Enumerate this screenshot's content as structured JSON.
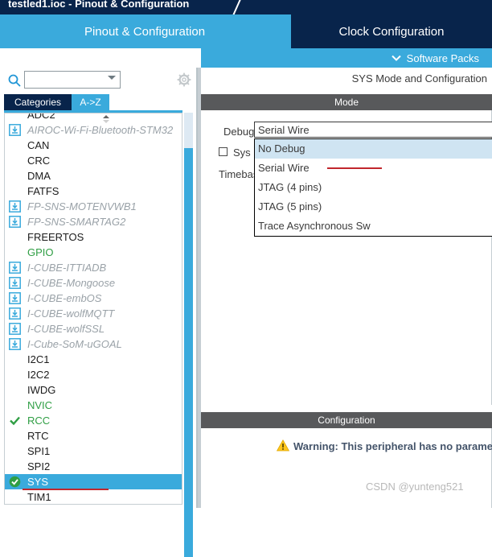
{
  "window": {
    "title": "testled1.ioc - Pinout & Configuration"
  },
  "main_tabs": [
    {
      "label": "Pinout & Configuration",
      "active": true
    },
    {
      "label": "Clock Configuration",
      "active": false
    }
  ],
  "software_packs": {
    "label": "Software Packs",
    "chevron": "⌄",
    "chevron_icon": "chevron-down-icon"
  },
  "sidebar": {
    "search": {
      "value": "",
      "placeholder": ""
    },
    "search_icon": "search-icon",
    "gear_icon": "gear-icon",
    "category_tabs": [
      {
        "label": "Categories",
        "active": false
      },
      {
        "label": "A->Z",
        "active": true
      }
    ],
    "items": [
      {
        "label": "ADC2",
        "style": "normal",
        "clipped": true
      },
      {
        "label": "AIROC-Wi-Fi-Bluetooth-STM32",
        "style": "plugin",
        "icon": "download-pack-icon"
      },
      {
        "label": "CAN",
        "style": "normal"
      },
      {
        "label": "CRC",
        "style": "normal"
      },
      {
        "label": "DMA",
        "style": "normal"
      },
      {
        "label": "FATFS",
        "style": "normal"
      },
      {
        "label": "FP-SNS-MOTENVWB1",
        "style": "plugin",
        "icon": "download-pack-icon"
      },
      {
        "label": "FP-SNS-SMARTAG2",
        "style": "plugin",
        "icon": "download-pack-icon"
      },
      {
        "label": "FREERTOS",
        "style": "normal"
      },
      {
        "label": "GPIO",
        "style": "green"
      },
      {
        "label": "I-CUBE-ITTIADB",
        "style": "plugin",
        "icon": "download-pack-icon"
      },
      {
        "label": "I-CUBE-Mongoose",
        "style": "plugin",
        "icon": "download-pack-icon"
      },
      {
        "label": "I-CUBE-embOS",
        "style": "plugin",
        "icon": "download-pack-icon"
      },
      {
        "label": "I-CUBE-wolfMQTT",
        "style": "plugin",
        "icon": "download-pack-icon"
      },
      {
        "label": "I-CUBE-wolfSSL",
        "style": "plugin",
        "icon": "download-pack-icon"
      },
      {
        "label": "I-Cube-SoM-uGOAL",
        "style": "plugin",
        "icon": "download-pack-icon"
      },
      {
        "label": "I2C1",
        "style": "normal"
      },
      {
        "label": "I2C2",
        "style": "normal"
      },
      {
        "label": "IWDG",
        "style": "normal"
      },
      {
        "label": "NVIC",
        "style": "green"
      },
      {
        "label": "RCC",
        "style": "green",
        "icon": "check-mark-icon"
      },
      {
        "label": "RTC",
        "style": "normal"
      },
      {
        "label": "SPI1",
        "style": "normal"
      },
      {
        "label": "SPI2",
        "style": "normal"
      },
      {
        "label": "SYS",
        "style": "selected",
        "icon": "check-circle-icon",
        "underline": true
      },
      {
        "label": "TIM1",
        "style": "normal",
        "clipped": true
      }
    ]
  },
  "right_panel": {
    "peripheral_header": "SYS Mode and Configuration",
    "mode_header": "Mode",
    "debug_label": "Debug",
    "debug_value": "Serial Wire",
    "sys_checkbox_label": "Sys",
    "sys_checkbox_checked": false,
    "timebase_label": "Timebase Source",
    "dropdown_options": [
      {
        "label": "No Debug",
        "highlighted": true
      },
      {
        "label": "Serial Wire",
        "highlighted": false,
        "redbar": true
      },
      {
        "label": "JTAG (4 pins)",
        "highlighted": false
      },
      {
        "label": "JTAG (5 pins)",
        "highlighted": false
      },
      {
        "label": "Trace Asynchronous Sw",
        "highlighted": false
      }
    ],
    "config_header": "Configuration",
    "warning_icon": "warning-triangle-icon",
    "warning_text": "Warning: This peripheral has no parameters to be configured.",
    "watermark": "CSDN @yunteng521"
  },
  "colors": {
    "accent_blue": "#3aaadc",
    "dark_navy": "#08244b",
    "header_gray": "#58595b",
    "warning_yellow": "#ffc107",
    "green": "#2f9e44",
    "red": "#c1272d"
  }
}
